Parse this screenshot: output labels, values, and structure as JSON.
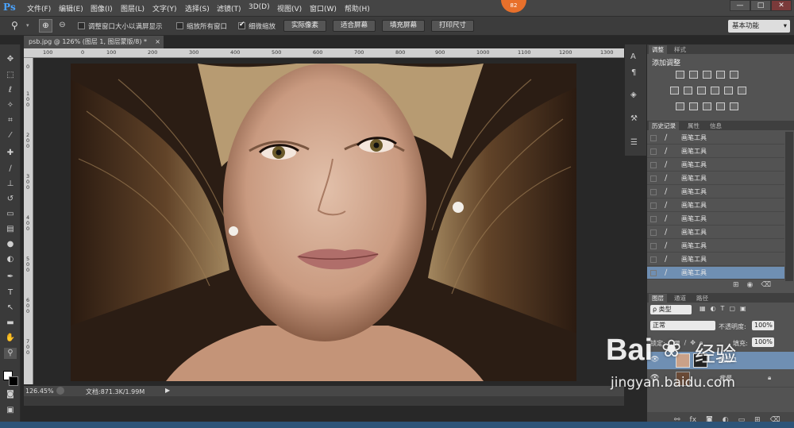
{
  "menubar": {
    "logo": "Ps",
    "items": [
      "文件(F)",
      "编辑(E)",
      "图像(I)",
      "图层(L)",
      "文字(Y)",
      "选择(S)",
      "滤镜(T)",
      "3D(D)",
      "视图(V)",
      "窗口(W)",
      "帮助(H)"
    ],
    "badge": "82",
    "minimize": "—",
    "restore": "□",
    "close": "✕"
  },
  "options": {
    "resize_windows": "调整窗口大小以满屏显示",
    "zoom_all_windows": "缩放所有窗口",
    "scrubby_zoom": "细微缩放",
    "actual_pixels": "实际像素",
    "fit_screen": "适合屏幕",
    "fill_screen": "填充屏幕",
    "print_size": "打印尺寸",
    "workspace": "基本功能"
  },
  "document": {
    "tab_title": "psb.jpg @ 126% (图层 1, 图层蒙版/8) *",
    "tab_close": "×",
    "ruler_h": [
      "100",
      "0",
      "100",
      "200",
      "300",
      "400",
      "500",
      "600",
      "700",
      "800",
      "900",
      "1000",
      "1100",
      "1200",
      "1300",
      "1400"
    ],
    "ruler_v": [
      "0",
      "1 0 0",
      "2 0 0",
      "3 0 0",
      "4 0 0",
      "5 0 0",
      "6 0 0",
      "7 0 0",
      "8 0 0"
    ]
  },
  "status": {
    "zoom": "126.45%",
    "doc_size": "文档:871.3K/1.99M"
  },
  "adjustments": {
    "tab_adjust": "调整",
    "tab_styles": "样式",
    "title": "添加调整"
  },
  "history": {
    "tab_history": "历史记录",
    "tab_properties": "属性",
    "tab_info": "信息",
    "items": [
      "画笔工具",
      "画笔工具",
      "画笔工具",
      "画笔工具",
      "画笔工具",
      "画笔工具",
      "画笔工具",
      "画笔工具",
      "画笔工具",
      "画笔工具",
      "画笔工具"
    ]
  },
  "layers": {
    "tab_layers": "图层",
    "tab_channels": "通道",
    "tab_paths": "路径",
    "kind": "ρ 类型",
    "blend_mode": "正常",
    "opacity_label": "不透明度:",
    "opacity_value": "100%",
    "lock_label": "锁定:",
    "fill_label": "填充:",
    "fill_value": "100%",
    "layer1_name": "图层 1",
    "background_name": "背景"
  },
  "watermark": {
    "brand": "Bai",
    "brand2": "经验",
    "url": "jingyan.baidu.com"
  }
}
